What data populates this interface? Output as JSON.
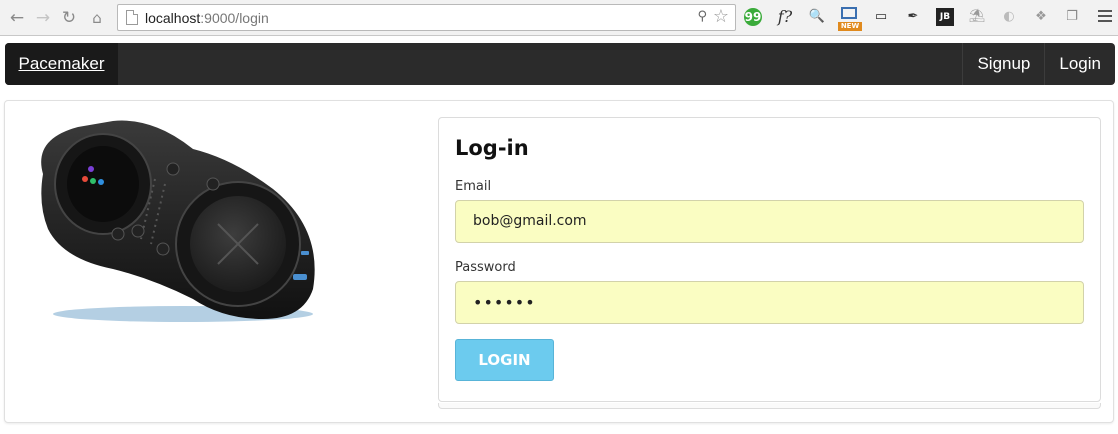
{
  "browser": {
    "url_host": "localhost",
    "url_path": ":9000/login",
    "extensions": [
      "hangouts-icon",
      "f?-icon",
      "magnifier-icon",
      "new-screen-icon",
      "cast-icon",
      "eyedropper-icon",
      "jb-icon",
      "palm-icon",
      "ghost-icon",
      "dropbox-icon",
      "copy-icon"
    ],
    "ext_f_label": "f?",
    "ext_jb_label": "JB",
    "ext_new_label": "NEW",
    "ext_hangouts_label": "99"
  },
  "navbar": {
    "brand": "Pacemaker",
    "items": [
      {
        "label": "Signup"
      },
      {
        "label": "Login"
      }
    ]
  },
  "login_form": {
    "title": "Log-in",
    "email_label": "Email",
    "email_value": "bob@gmail.com",
    "password_label": "Password",
    "password_value": "••••••",
    "submit_label": "LOGIN"
  },
  "colors": {
    "navbar_bg": "#2b2b2b",
    "brand_bg": "#1a1a1a",
    "input_autofill": "#fafdc2",
    "button": "#6ccbee"
  }
}
